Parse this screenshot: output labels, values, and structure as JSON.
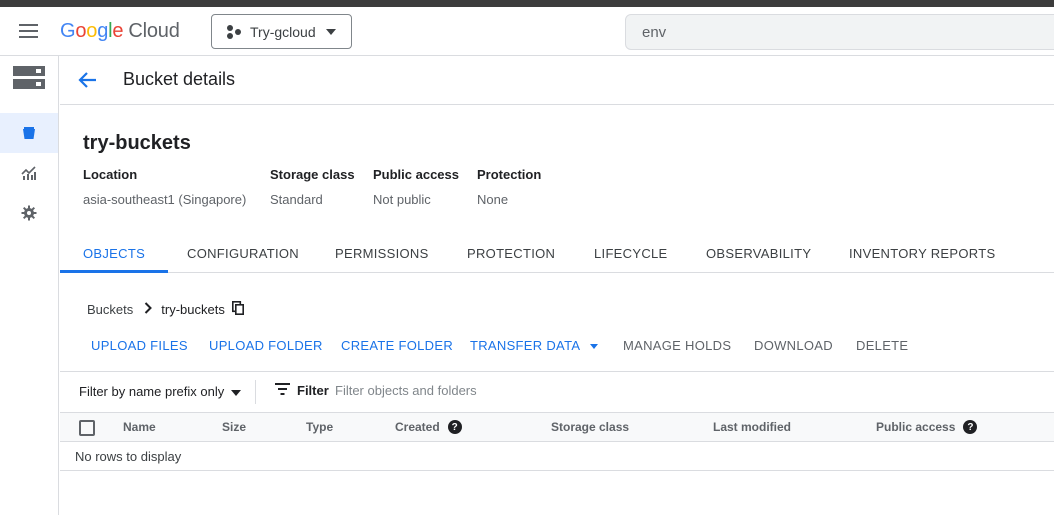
{
  "header": {
    "logo": {
      "g": "G",
      "o1": "o",
      "o2": "o",
      "g2": "g",
      "l": "l",
      "e": "e",
      "cloud": "Cloud"
    },
    "project": "Try-gcloud",
    "search_value": "env"
  },
  "page": {
    "title": "Bucket details"
  },
  "bucket": {
    "name": "try-buckets",
    "meta": [
      {
        "label": "Location",
        "value": "asia-southeast1 (Singapore)"
      },
      {
        "label": "Storage class",
        "value": "Standard"
      },
      {
        "label": "Public access",
        "value": "Not public"
      },
      {
        "label": "Protection",
        "value": "None"
      }
    ]
  },
  "tabs": [
    "OBJECTS",
    "CONFIGURATION",
    "PERMISSIONS",
    "PROTECTION",
    "LIFECYCLE",
    "OBSERVABILITY",
    "INVENTORY REPORTS"
  ],
  "breadcrumb": {
    "root": "Buckets",
    "current": "try-buckets"
  },
  "actions": {
    "upload_files": "UPLOAD FILES",
    "upload_folder": "UPLOAD FOLDER",
    "create_folder": "CREATE FOLDER",
    "transfer_data": "TRANSFER DATA",
    "manage_holds": "MANAGE HOLDS",
    "download": "DOWNLOAD",
    "delete": "DELETE"
  },
  "filter": {
    "prefix_mode": "Filter by name prefix only",
    "button": "Filter",
    "placeholder": "Filter objects and folders"
  },
  "table": {
    "columns": [
      "Name",
      "Size",
      "Type",
      "Created",
      "Storage class",
      "Last modified",
      "Public access"
    ],
    "empty_text": "No rows to display"
  },
  "colors": {
    "accent": "#1a73e8",
    "active_bg": "#e8f0fe",
    "border": "#dadce0"
  }
}
